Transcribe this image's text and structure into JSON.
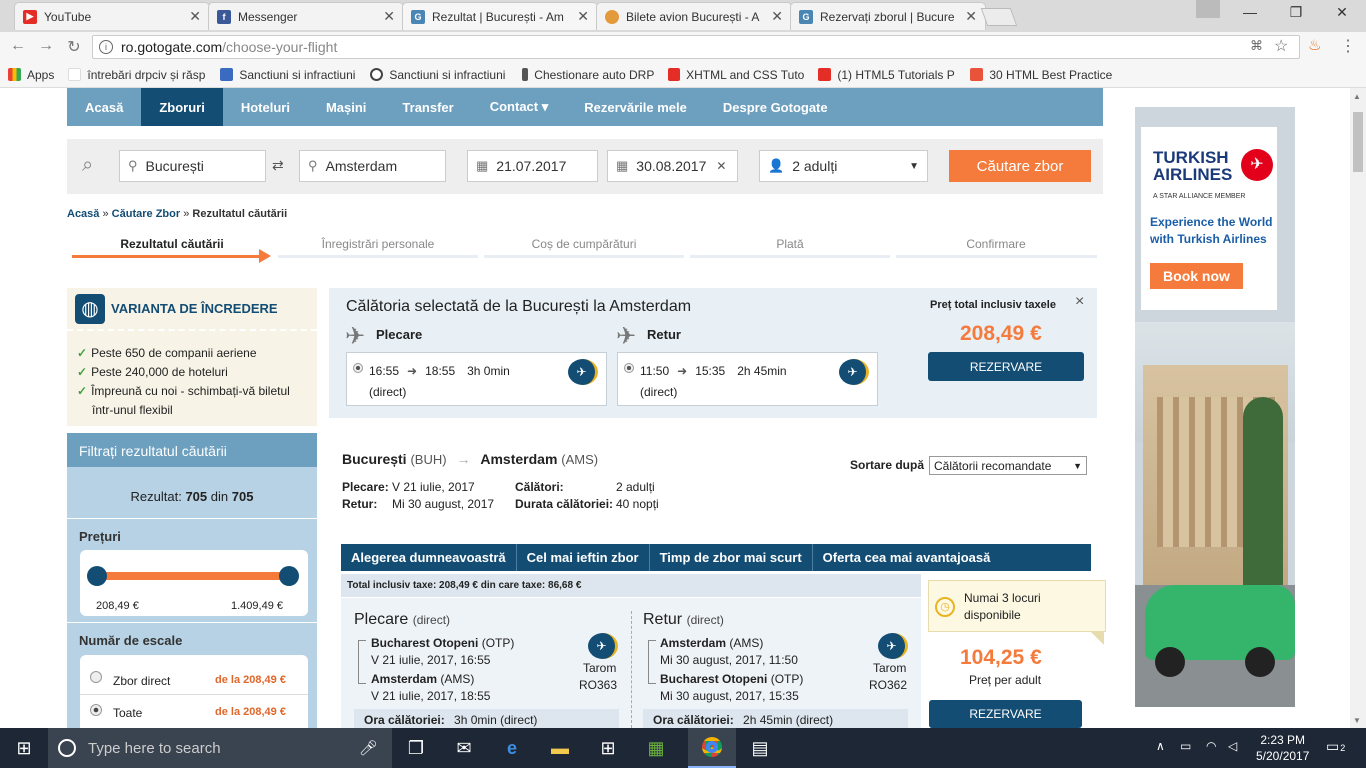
{
  "browser": {
    "tabs": [
      {
        "title": "YouTube",
        "favicon": "youtube-icon",
        "color": "#e52d27"
      },
      {
        "title": "Messenger",
        "favicon": "facebook-icon",
        "color": "#3b5998"
      },
      {
        "title": "Rezultat | București - Am",
        "favicon": "gotogate-icon",
        "color": "#4a86b4"
      },
      {
        "title": "Bilete avion București - A",
        "favicon": "pinwheel-icon",
        "color": "#e39a3b"
      },
      {
        "title": "Rezervați zborul | Bucure",
        "favicon": "gotogate-icon",
        "color": "#4a86b4"
      }
    ],
    "url_host": "ro.gotogate.com",
    "url_path": "/choose-your-flight",
    "bookmarks": [
      {
        "label": "Apps",
        "color": "#e94235"
      },
      {
        "label": "întrebări drpciv și răsp",
        "color": "#ffffff"
      },
      {
        "label": "Sanctiuni si infractiuni",
        "color": "#3b6bc1"
      },
      {
        "label": "Sanctiuni si infractiuni",
        "color": "#444444"
      },
      {
        "label": "Chestionare auto DRP",
        "color": "#555555"
      },
      {
        "label": "XHTML and CSS Tuto",
        "color": "#e52d27"
      },
      {
        "label": "(1) HTML5 Tutorials P",
        "color": "#e52d27"
      },
      {
        "label": "30 HTML Best Practice",
        "color": "#e8533a"
      }
    ]
  },
  "nav": {
    "items": [
      "Acasă",
      "Zboruri",
      "Hoteluri",
      "Mașini",
      "Transfer",
      "Contact ▾",
      "Rezervările mele",
      "Despre Gotogate"
    ],
    "active_index": 1
  },
  "search": {
    "from": "București",
    "to": "Amsterdam",
    "depart": "21.07.2017",
    "return": "30.08.2017",
    "passengers": "2 adulți",
    "button": "Căutare zbor"
  },
  "breadcrumb": {
    "home": "Acasă",
    "search": "Căutare Zbor",
    "current": "Rezultatul căutării",
    "sep": "»"
  },
  "steps": [
    "Rezultatul căutării",
    "Înregistrări personale",
    "Coș de cumpărături",
    "Plată",
    "Confirmare"
  ],
  "trust": {
    "title": "VARIANTA DE ÎNCREDERE",
    "items": [
      "Peste 650 de companii aeriene",
      "Peste 240,000 de hoteluri",
      "Împreună cu noi - schimbați-vă biletul",
      "într-unul flexibil"
    ]
  },
  "filter": {
    "title": "Filtrați rezultatul căutării",
    "result_label": "Rezultat:",
    "result_count": "705",
    "result_of": "din",
    "result_total": "705",
    "prices_label": "Prețuri",
    "price_min": "208,49 €",
    "price_max": "1.409,49 €",
    "stops_label": "Număr de escale",
    "stops": [
      {
        "label": "Zbor direct",
        "price": "de la 208,49 €"
      },
      {
        "label": "Toate",
        "price": "de la 208,49 €"
      }
    ]
  },
  "selected": {
    "title": "Călătoria selectată de la București la Amsterdam",
    "out_label": "Plecare",
    "ret_label": "Retur",
    "out": {
      "dep": "16:55",
      "arr": "18:55",
      "dur": "3h 0min",
      "type": "(direct)"
    },
    "ret": {
      "dep": "11:50",
      "arr": "15:35",
      "dur": "2h 45min",
      "type": "(direct)"
    },
    "price_label": "Preț total inclusiv taxele",
    "price": "208,49 €",
    "book": "REZERVARE",
    "close": "×"
  },
  "route": {
    "from": "București",
    "from_code": "(BUH)",
    "to": "Amsterdam",
    "to_code": "(AMS)",
    "dep_label": "Plecare:",
    "dep_val": "V 21 iulie, 2017",
    "ret_label": "Retur:",
    "ret_val": "Mi 30 august, 2017",
    "trav_label": "Călători:",
    "trav_val": "2 adulți",
    "dur_label": "Durata călătoriei:",
    "dur_val": "40 nopți",
    "sort_label": "Sortare după",
    "sort_value": "Călătorii recomandate"
  },
  "result_tabs": [
    "Alegerea dumneavoastră",
    "Cel mai ieftin zbor",
    "Timp de zbor mai scurt",
    "Oferta cea mai avantajoasă"
  ],
  "result": {
    "total_line": "Total inclusiv taxe: 208,49 € din care taxe: 86,68 €",
    "out_title": "Plecare",
    "out_sub": "(direct)",
    "out_from": "Bucharest Otopeni",
    "out_from_code": "(OTP)",
    "out_from_date": "V 21 iulie, 2017, 16:55",
    "out_to": "Amsterdam",
    "out_to_code": "(AMS)",
    "out_to_date": "V 21 iulie, 2017, 18:55",
    "out_airline": "Tarom",
    "out_flight": "RO363",
    "out_time_label": "Ora călătoriei:",
    "out_time": "3h 0min (direct)",
    "ret_title": "Retur",
    "ret_sub": "(direct)",
    "ret_from": "Amsterdam",
    "ret_from_code": "(AMS)",
    "ret_from_date": "Mi 30 august, 2017, 11:50",
    "ret_to": "Bucharest Otopeni",
    "ret_to_code": "(OTP)",
    "ret_to_date": "Mi 30 august, 2017, 15:35",
    "ret_airline": "Tarom",
    "ret_flight": "RO362",
    "ret_time_label": "Ora călătoriei:",
    "ret_time": "2h 45min (direct)",
    "seats_note": "Numai 3 locuri disponibile",
    "price": "104,25 €",
    "price_sub": "Preț per adult",
    "book": "REZERVARE"
  },
  "ad": {
    "brand_line1": "TURKISH",
    "brand_line2": "AIRLINES",
    "member": "A STAR ALLIANCE MEMBER",
    "tagline": "Experience the World with Turkish Airlines",
    "cta": "Book now"
  },
  "taskbar": {
    "search_placeholder": "Type here to search",
    "time": "2:23 PM",
    "date": "5/20/2017",
    "notifications": "2"
  }
}
